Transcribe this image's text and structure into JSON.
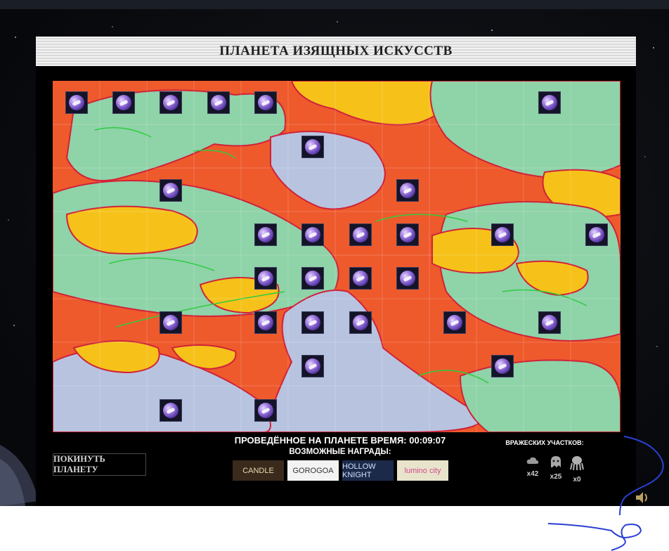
{
  "planet": {
    "title": "ПЛАНЕТА ИЗЯЩНЫХ ИСКУССТВ"
  },
  "status": {
    "time_text": "ПРОВЕДЁННОЕ НА ПЛАНЕТЕ ВРЕМЯ: 00:09:07",
    "rewards_label": "ВОЗМОЖНЫЕ НАГРАДЫ:"
  },
  "leave_button": {
    "label": "ПОКИНУТЬ ПЛАНЕТУ"
  },
  "rewards": [
    {
      "name": "CANDLE",
      "bg": "#3a2a1c",
      "fg": "#e8d8b0"
    },
    {
      "name": "GOROGOA",
      "bg": "#f3f3f3",
      "fg": "#333333"
    },
    {
      "name": "HOLLOW KNIGHT",
      "bg": "#1c2a4a",
      "fg": "#cfe2ff"
    },
    {
      "name": "lumino city",
      "bg": "#e8e4cc",
      "fg": "#d04a8a"
    }
  ],
  "enemies": {
    "label": "ВРАЖЕСКИХ УЧАСТКОВ:",
    "items": [
      {
        "icon": "cloud-icon",
        "count": "x42"
      },
      {
        "icon": "ghost-icon",
        "count": "x25"
      },
      {
        "icon": "octopus-icon",
        "count": "x0"
      }
    ]
  },
  "grid": {
    "cols": 12,
    "rows": 8,
    "icon": "steam-orb-icon",
    "occupied": [
      [
        0,
        0
      ],
      [
        1,
        0
      ],
      [
        2,
        0
      ],
      [
        3,
        0
      ],
      [
        4,
        0
      ],
      [
        10,
        0
      ],
      [
        5,
        1
      ],
      [
        2,
        2
      ],
      [
        7,
        2
      ],
      [
        4,
        3
      ],
      [
        5,
        3
      ],
      [
        6,
        3
      ],
      [
        7,
        3
      ],
      [
        9,
        3
      ],
      [
        11,
        3
      ],
      [
        4,
        4
      ],
      [
        5,
        4
      ],
      [
        6,
        4
      ],
      [
        7,
        4
      ],
      [
        2,
        5
      ],
      [
        4,
        5
      ],
      [
        5,
        5
      ],
      [
        6,
        5
      ],
      [
        8,
        5
      ],
      [
        10,
        5
      ],
      [
        5,
        6
      ],
      [
        9,
        6
      ],
      [
        2,
        7
      ],
      [
        4,
        7
      ]
    ]
  },
  "colors": {
    "lava": "#ee5a2c",
    "sand": "#f6c21a",
    "ice": "#b8c4df",
    "grass": "#8fd3a8",
    "outline": "#d0223a",
    "moss": "#2ecc40"
  }
}
